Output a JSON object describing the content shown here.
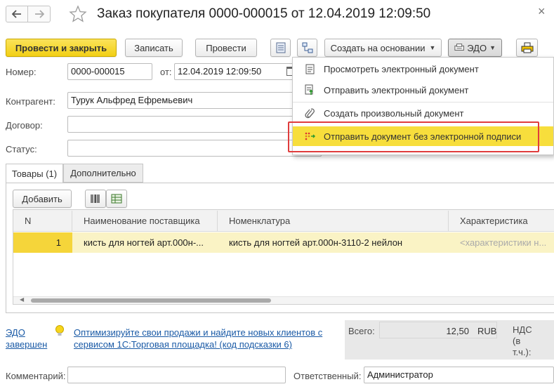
{
  "window": {
    "title": "Заказ покупателя 0000-000015 от 12.04.2019 12:09:50",
    "close_glyph": "×"
  },
  "toolbar": {
    "post_close": "Провести и закрыть",
    "save": "Записать",
    "post": "Провести",
    "create_based": "Создать на основании",
    "edo": "ЭДО"
  },
  "form": {
    "number_label": "Номер:",
    "number_value": "0000-000015",
    "from_label": "от:",
    "date_value": "12.04.2019 12:09:50",
    "counterparty_label": "Контрагент:",
    "counterparty_value": "Турук Альфред Ефремьевич",
    "contract_label": "Договор:",
    "contract_value": "",
    "status_label": "Статус:",
    "status_value": ""
  },
  "edo_menu": {
    "items": [
      {
        "label": "Просмотреть электронный документ",
        "icon": "document-view-icon"
      },
      {
        "label": "Отправить электронный документ",
        "icon": "document-send-icon"
      },
      {
        "label": "Создать произвольный документ",
        "icon": "paperclip-icon"
      },
      {
        "label": "Отправить документ без электронной подписи",
        "icon": "send-unsigned-icon"
      }
    ],
    "highlight_color": "#f7de3c",
    "outline_color": "#e03c3c"
  },
  "tabs": {
    "goods": "Товары (1)",
    "additional": "Дополнительно"
  },
  "table_toolbar": {
    "add": "Добавить"
  },
  "table": {
    "headers": [
      "N",
      "Наименование поставщика",
      "Номенклатура",
      "Характеристика"
    ],
    "rows": [
      {
        "n": "1",
        "supplier_name": "кисть для ногтей арт.000н-...",
        "nomenclature": "кисть для ногтей арт.000н-3110-2 нейлон",
        "characteristic": "<характеристики н..."
      }
    ]
  },
  "footer": {
    "edo_status_line1": "ЭДО",
    "edo_status_line2": "завершен",
    "promo_line1": "Оптимизируйте свои продажи и найдите новых клиентов с",
    "promo_line2": "сервисом 1С:Торговая площадка! (код подсказки 6)",
    "total_label": "Всего:",
    "total_value": "12,50",
    "currency": "RUB",
    "vat_line1": "НДС",
    "vat_line2": "(в",
    "vat_line3": "т.ч.):",
    "comment_label": "Комментарий:",
    "comment_value": "",
    "responsible_label": "Ответственный:",
    "responsible_value": "Администратор"
  }
}
